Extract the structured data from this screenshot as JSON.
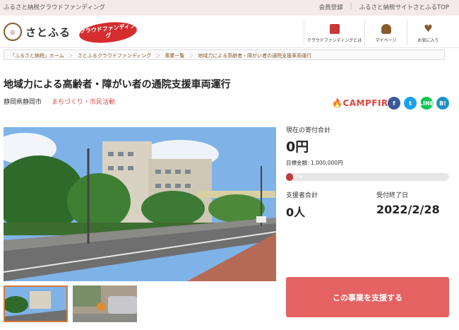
{
  "topbar": {
    "tagline": "ふるさと納税クラウドファンディング",
    "links": [
      "会員登録",
      "ふるさと納税サイトさとふるTOP"
    ]
  },
  "header": {
    "logo_mark": "さとふる",
    "logo_text": "さとふる",
    "badge": "クラウドファンディング",
    "nav": [
      {
        "label": "クラウドファンディングとは",
        "icon": "book-icon"
      },
      {
        "label": "マイページ",
        "icon": "user-icon"
      },
      {
        "label": "お気に入り",
        "icon": "heart-icon"
      }
    ]
  },
  "breadcrumb": [
    "「ふるさと納税」ホーム",
    "さとふるクラウドファンディング",
    "事業一覧",
    "地域力による高齢者・障がい者の通院支援車両運行"
  ],
  "project": {
    "title": "地域力による高齢者・障がい者の通院支援車両運行",
    "location": "静岡県静岡市",
    "category": "まちづくり・市民活動",
    "platform": "CAMPFIRE",
    "share": [
      "f",
      "t",
      "LINE",
      "B!"
    ]
  },
  "funding": {
    "current_label": "現在の寄付合計",
    "current_value": "0円",
    "goal": "目標金額: 1,000,000円",
    "progress_pct": 0,
    "progress_text": "0%",
    "supporters_label": "支援者合計",
    "supporters_value": "0人",
    "deadline_label": "受付終了日",
    "deadline_value": "2022/2/28",
    "cta": "この事業を支援する"
  },
  "colors": {
    "accent": "#e56262",
    "brand_brown": "#8a5a2b",
    "topbar_bg": "#f6e9e9"
  }
}
